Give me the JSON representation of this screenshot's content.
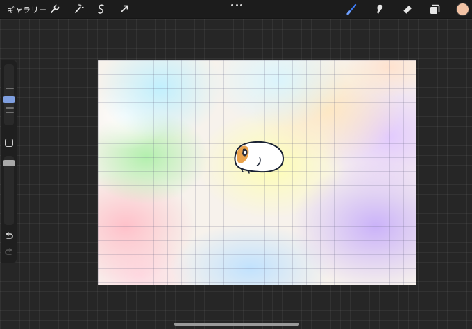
{
  "topbar": {
    "gallery_label": "ギャラリー",
    "left_tools": [
      {
        "name": "wrench-icon"
      },
      {
        "name": "magic-wand-icon"
      },
      {
        "name": "selection-icon"
      },
      {
        "name": "transform-arrow-icon"
      }
    ],
    "right_tools": [
      {
        "name": "brush-icon",
        "active": true
      },
      {
        "name": "smudge-icon",
        "active": false
      },
      {
        "name": "eraser-icon",
        "active": false
      },
      {
        "name": "layers-icon",
        "active": false
      }
    ],
    "current_color": "#f2c2a4"
  },
  "sidebar": {
    "brush_size_handle_color": "#7f9fe0",
    "opacity_handle_color": "#a8a8a8",
    "icons": [
      "modify-square-icon",
      "undo-icon",
      "redo-icon"
    ]
  },
  "colors": {
    "accent": "#3d7bf5",
    "toolbar_bg": "#1c1c1c",
    "workspace_bg": "#262626"
  }
}
